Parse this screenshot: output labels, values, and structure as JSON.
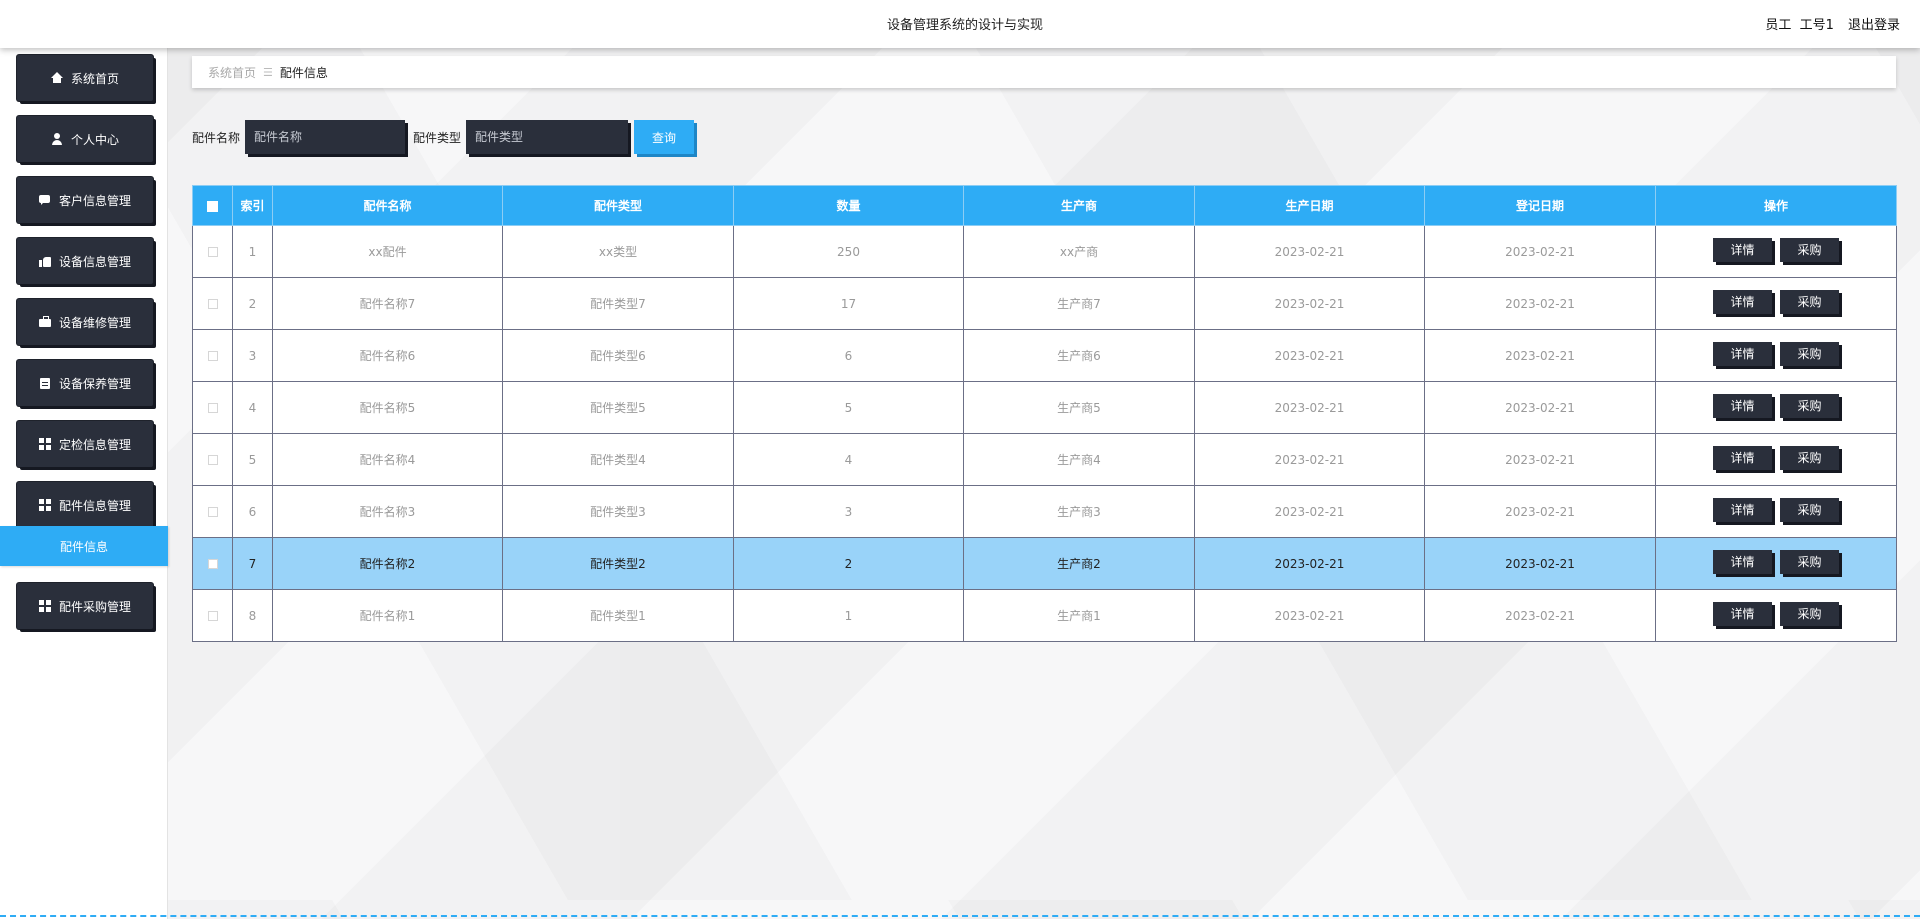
{
  "header": {
    "title": "设备管理系统的设计与实现",
    "role": "员工",
    "username": "工号1",
    "logout_label": "退出登录"
  },
  "sidebar": {
    "items": [
      {
        "label": "系统首页",
        "icon": "home-icon"
      },
      {
        "label": "个人中心",
        "icon": "user-icon"
      },
      {
        "label": "客户信息管理",
        "icon": "chat-icon"
      },
      {
        "label": "设备信息管理",
        "icon": "thumb-icon"
      },
      {
        "label": "设备维修管理",
        "icon": "briefcase-icon"
      },
      {
        "label": "设备保养管理",
        "icon": "clipboard-icon"
      },
      {
        "label": "定检信息管理",
        "icon": "grid-icon"
      },
      {
        "label": "配件信息管理",
        "icon": "grid-icon"
      },
      {
        "label": "配件采购管理",
        "icon": "grid-icon"
      }
    ],
    "active_submenu": "配件信息"
  },
  "breadcrumb": {
    "home": "系统首页",
    "separator": "☰",
    "current": "配件信息"
  },
  "search": {
    "name_label": "配件名称",
    "name_placeholder": "配件名称",
    "type_label": "配件类型",
    "type_placeholder": "配件类型",
    "query_label": "查询"
  },
  "table": {
    "headers": [
      "索引",
      "配件名称",
      "配件类型",
      "数量",
      "生产商",
      "生产日期",
      "登记日期",
      "操作"
    ],
    "detail_label": "详情",
    "buy_label": "采购",
    "rows": [
      {
        "index": "1",
        "name": "xx配件",
        "type": "xx类型",
        "qty": "250",
        "maker": "xx产商",
        "prod_date": "2023-02-21",
        "reg_date": "2023-02-21"
      },
      {
        "index": "2",
        "name": "配件名称7",
        "type": "配件类型7",
        "qty": "17",
        "maker": "生产商7",
        "prod_date": "2023-02-21",
        "reg_date": "2023-02-21"
      },
      {
        "index": "3",
        "name": "配件名称6",
        "type": "配件类型6",
        "qty": "6",
        "maker": "生产商6",
        "prod_date": "2023-02-21",
        "reg_date": "2023-02-21"
      },
      {
        "index": "4",
        "name": "配件名称5",
        "type": "配件类型5",
        "qty": "5",
        "maker": "生产商5",
        "prod_date": "2023-02-21",
        "reg_date": "2023-02-21"
      },
      {
        "index": "5",
        "name": "配件名称4",
        "type": "配件类型4",
        "qty": "4",
        "maker": "生产商4",
        "prod_date": "2023-02-21",
        "reg_date": "2023-02-21"
      },
      {
        "index": "6",
        "name": "配件名称3",
        "type": "配件类型3",
        "qty": "3",
        "maker": "生产商3",
        "prod_date": "2023-02-21",
        "reg_date": "2023-02-21"
      },
      {
        "index": "7",
        "name": "配件名称2",
        "type": "配件类型2",
        "qty": "2",
        "maker": "生产商2",
        "prod_date": "2023-02-21",
        "reg_date": "2023-02-21"
      },
      {
        "index": "8",
        "name": "配件名称1",
        "type": "配件类型1",
        "qty": "1",
        "maker": "生产商1",
        "prod_date": "2023-02-21",
        "reg_date": "2023-02-21"
      }
    ],
    "selected_row": 6
  },
  "colors": {
    "accent": "#2eacf5",
    "dark_button": "#2a2f3b",
    "selected_row": "#99d3f9"
  }
}
